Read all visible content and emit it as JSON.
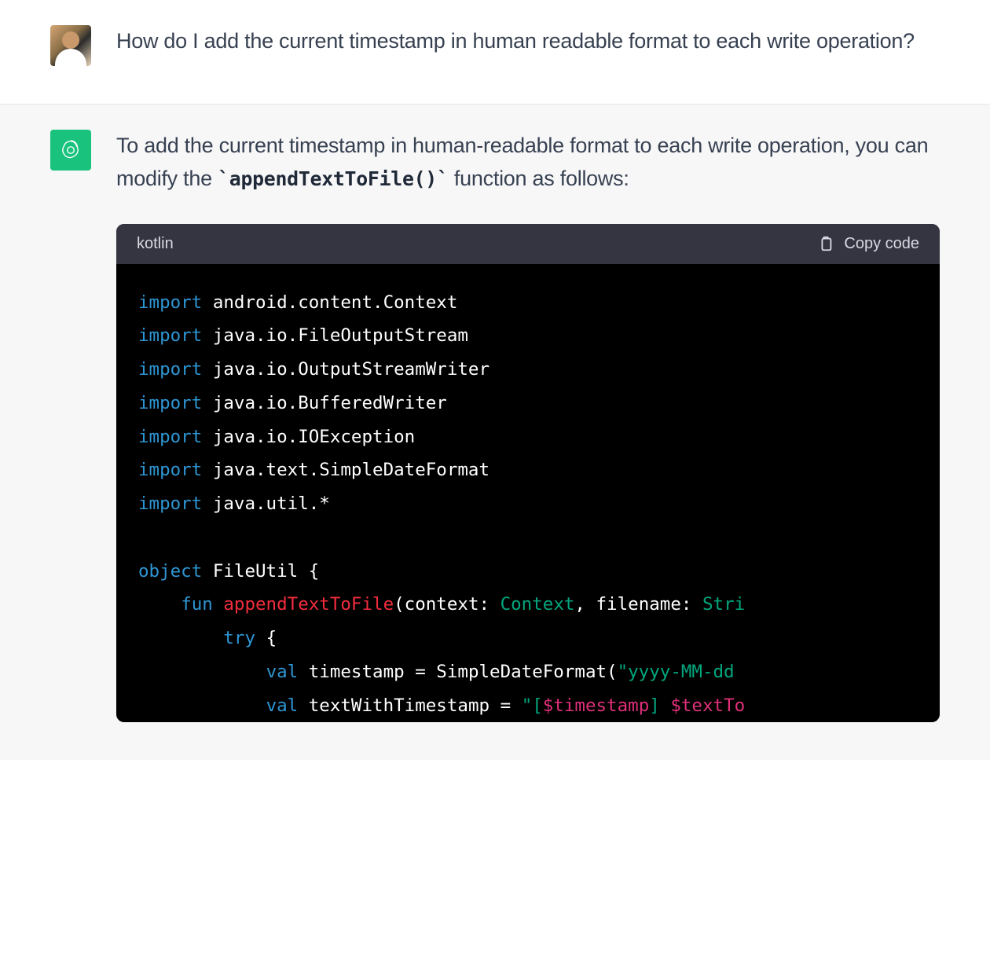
{
  "user_message": {
    "text": "How do I add the current timestamp in human readable format to each write operation?"
  },
  "assistant_message": {
    "intro_before": "To add the current timestamp in human-readable format to each write operation, you can modify the ",
    "inline_code": "`appendTextToFile()`",
    "intro_after": " function as follows:"
  },
  "code_block": {
    "language": "kotlin",
    "copy_label": "Copy code",
    "tokens": [
      {
        "t": "kw",
        "v": "import"
      },
      {
        "t": "sp",
        "v": " "
      },
      {
        "t": "pl",
        "v": "android.content.Context"
      },
      {
        "t": "nl"
      },
      {
        "t": "kw",
        "v": "import"
      },
      {
        "t": "sp",
        "v": " "
      },
      {
        "t": "pl",
        "v": "java.io.FileOutputStream"
      },
      {
        "t": "nl"
      },
      {
        "t": "kw",
        "v": "import"
      },
      {
        "t": "sp",
        "v": " "
      },
      {
        "t": "pl",
        "v": "java.io.OutputStreamWriter"
      },
      {
        "t": "nl"
      },
      {
        "t": "kw",
        "v": "import"
      },
      {
        "t": "sp",
        "v": " "
      },
      {
        "t": "pl",
        "v": "java.io.BufferedWriter"
      },
      {
        "t": "nl"
      },
      {
        "t": "kw",
        "v": "import"
      },
      {
        "t": "sp",
        "v": " "
      },
      {
        "t": "pl",
        "v": "java.io.IOException"
      },
      {
        "t": "nl"
      },
      {
        "t": "kw",
        "v": "import"
      },
      {
        "t": "sp",
        "v": " "
      },
      {
        "t": "pl",
        "v": "java.text.SimpleDateFormat"
      },
      {
        "t": "nl"
      },
      {
        "t": "kw",
        "v": "import"
      },
      {
        "t": "sp",
        "v": " "
      },
      {
        "t": "pl",
        "v": "java.util.*"
      },
      {
        "t": "nl"
      },
      {
        "t": "nl"
      },
      {
        "t": "kw",
        "v": "object"
      },
      {
        "t": "sp",
        "v": " "
      },
      {
        "t": "pl",
        "v": "FileUtil {"
      },
      {
        "t": "nl"
      },
      {
        "t": "sp",
        "v": "    "
      },
      {
        "t": "kw",
        "v": "fun"
      },
      {
        "t": "sp",
        "v": " "
      },
      {
        "t": "fn",
        "v": "appendTextToFile"
      },
      {
        "t": "pl",
        "v": "(context: "
      },
      {
        "t": "type",
        "v": "Context"
      },
      {
        "t": "pl",
        "v": ", filename: "
      },
      {
        "t": "type",
        "v": "Stri"
      },
      {
        "t": "nl"
      },
      {
        "t": "sp",
        "v": "        "
      },
      {
        "t": "kw",
        "v": "try"
      },
      {
        "t": "sp",
        "v": " "
      },
      {
        "t": "pl",
        "v": "{"
      },
      {
        "t": "nl"
      },
      {
        "t": "sp",
        "v": "            "
      },
      {
        "t": "kw",
        "v": "val"
      },
      {
        "t": "sp",
        "v": " "
      },
      {
        "t": "pl",
        "v": "timestamp = SimpleDateFormat("
      },
      {
        "t": "str",
        "v": "\"yyyy-MM-dd"
      },
      {
        "t": "nl"
      },
      {
        "t": "sp",
        "v": "            "
      },
      {
        "t": "kw",
        "v": "val"
      },
      {
        "t": "sp",
        "v": " "
      },
      {
        "t": "pl",
        "v": "textWithTimestamp = "
      },
      {
        "t": "str",
        "v": "\"["
      },
      {
        "t": "intp",
        "v": "$timestamp"
      },
      {
        "t": "str",
        "v": "] "
      },
      {
        "t": "intp",
        "v": "$textTo"
      }
    ]
  }
}
